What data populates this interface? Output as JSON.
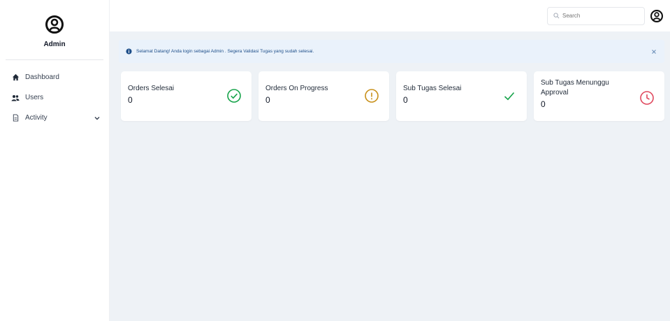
{
  "sidebar": {
    "profile_name": "Admin",
    "items": [
      {
        "label": "Dashboard",
        "icon": "home-icon"
      },
      {
        "label": "Users",
        "icon": "users-icon"
      },
      {
        "label": "Activity",
        "icon": "document-icon"
      }
    ]
  },
  "topbar": {
    "search_placeholder": "Search"
  },
  "alert": {
    "message": "Selamat Datang! Anda login sebagai Admin . Segera Validasi Tugas yang sudah selesai."
  },
  "cards": [
    {
      "title": "Orders Selesai",
      "value": "0",
      "icon": "check-circle-icon",
      "color": "#16a34a"
    },
    {
      "title": "Orders On Progress",
      "value": "0",
      "icon": "exclamation-circle-icon",
      "color": "#c8901a"
    },
    {
      "title": "Sub Tugas Selesai",
      "value": "0",
      "icon": "check-icon",
      "color": "#16a34a"
    },
    {
      "title": "Sub Tugas Menunggu Approval",
      "value": "0",
      "icon": "clock-icon",
      "color": "#e04a5f"
    }
  ]
}
